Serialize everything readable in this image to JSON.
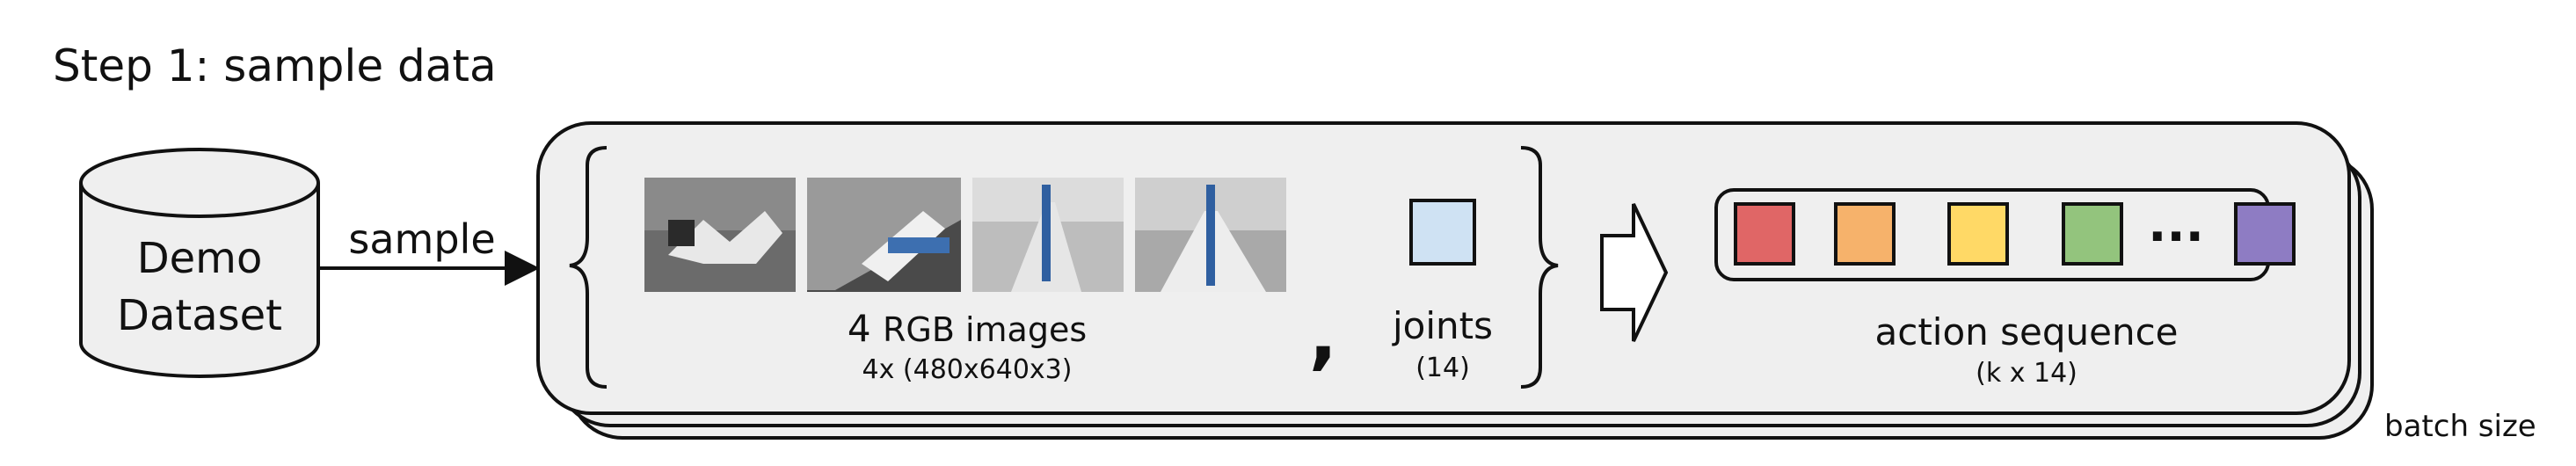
{
  "title": "Step 1: sample data",
  "dataset": {
    "line1": "Demo",
    "line2": "Dataset"
  },
  "arrow_label": "sample",
  "images": {
    "count_prefix": "4",
    "label": "RGB images",
    "sublabel": "4x (480x640x3)",
    "thumbnails": [
      "camera-view-1",
      "camera-view-2",
      "camera-view-3",
      "camera-view-4"
    ]
  },
  "comma": ",",
  "joints": {
    "label": "joints",
    "sublabel": "(14)",
    "color": "#cfe2f3"
  },
  "action_sequence": {
    "label": "action sequence",
    "sublabel": "(k x 14)",
    "ellipsis": "···",
    "tokens": [
      "#e06666",
      "#f6b26b",
      "#ffd966",
      "#93c47d",
      "#8e7cc3"
    ]
  },
  "batch_label": "batch size"
}
